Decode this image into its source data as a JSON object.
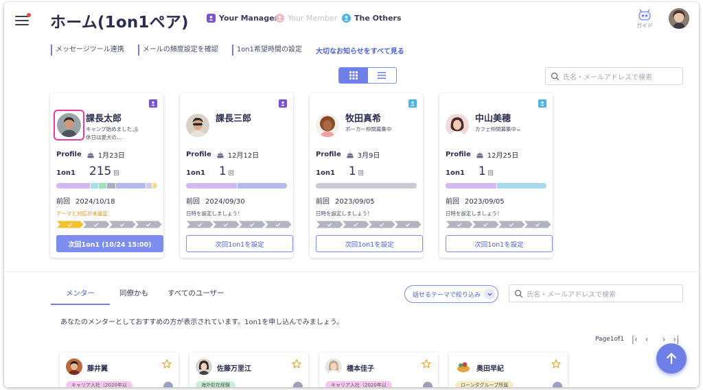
{
  "header": {
    "title": "ホーム(1on1ペア)",
    "legend": [
      {
        "label": "Your Manager",
        "color": "#7d4fd6",
        "active": true
      },
      {
        "label": "Your Member",
        "color": "#f0b8c0",
        "active": false
      },
      {
        "label": "The Others",
        "color": "#4db4e6",
        "active": true
      }
    ],
    "guide_label": "ガイド"
  },
  "links": [
    {
      "label": "メッセージツール連携"
    },
    {
      "label": "メールの頻度設定を確認"
    },
    {
      "label": "1on1希望時間の設定"
    }
  ],
  "all_notices_link": "大切なお知らせをすべて見る",
  "search_top": {
    "placeholder": "氏名・メールアドレスで検索"
  },
  "pair_cards": [
    {
      "name": "課長太郎",
      "role_icon": "manager-icon",
      "role_color": "#7d4fd6",
      "bio_line1": "キャンプ始めました🏕",
      "bio_line2": "休日は愛犬の…",
      "profile_label": "Profile",
      "birthday": "1月23日",
      "one_on_one_label": "1on1",
      "count": "215",
      "count_unit": "回",
      "bar_segments": [
        {
          "color": "#d3b8f1",
          "weight": 35
        },
        {
          "color": "#a7dfe8",
          "weight": 9
        },
        {
          "color": "#a6e0b9",
          "weight": 9
        },
        {
          "color": "#a9aec4",
          "weight": 9
        },
        {
          "color": "#b3b8ef",
          "weight": 32
        },
        {
          "color": "#c9cced",
          "weight": 6
        },
        {
          "color": "#f3dc92",
          "weight": 6
        }
      ],
      "prev_label": "前回",
      "prev_date": "2024/10/18",
      "note": "テーマと対応が未設定",
      "note_warn": true,
      "steps_done": 1,
      "button_label": "次回1on1 (10/24 15:00)",
      "button_filled": true
    },
    {
      "name": "課長三郎",
      "role_icon": "manager-icon",
      "role_color": "#7d4fd6",
      "bio_line1": "",
      "bio_line2": "",
      "profile_label": "Profile",
      "birthday": "12月12日",
      "one_on_one_label": "1on1",
      "count": "1",
      "count_unit": "回",
      "bar_segments": [
        {
          "color": "#d3b8f1",
          "weight": 50
        },
        {
          "color": "#b3b8ef",
          "weight": 50
        }
      ],
      "prev_label": "前回",
      "prev_date": "2024/09/30",
      "note": "日時を設定しましょう！",
      "note_warn": false,
      "steps_done": 0,
      "button_label": "次回1on1を設定",
      "button_filled": false
    },
    {
      "name": "牧田真希",
      "role_icon": "others-icon",
      "role_color": "#4db4e6",
      "bio_line1": "ポーカー仲間募集中",
      "bio_line2": "",
      "profile_label": "Profile",
      "birthday": "3月9日",
      "one_on_one_label": "1on1",
      "count": "1",
      "count_unit": "回",
      "bar_segments": [
        {
          "color": "#c9cad2",
          "weight": 100
        }
      ],
      "prev_label": "前回",
      "prev_date": "2023/09/05",
      "note": "日時を設定しましょう！",
      "note_warn": false,
      "steps_done": 0,
      "button_label": "次回1on1を設定",
      "button_filled": false
    },
    {
      "name": "中山美穂",
      "role_icon": "others-icon",
      "role_color": "#4db4e6",
      "bio_line1": "カフェ仲間募集中☕",
      "bio_line2": "",
      "profile_label": "Profile",
      "birthday": "12月25日",
      "one_on_one_label": "1on1",
      "count": "1",
      "count_unit": "回",
      "bar_segments": [
        {
          "color": "#d3b8f1",
          "weight": 50
        },
        {
          "color": "#a7d8ef",
          "weight": 50
        }
      ],
      "prev_label": "前回",
      "prev_date": "2023/09/05",
      "note": "日時を設定しましょう！",
      "note_warn": false,
      "steps_done": 0,
      "button_label": "次回1on1を設定",
      "button_filled": false
    }
  ],
  "tabs": [
    {
      "label": "メンター",
      "active": true
    },
    {
      "label": "同僚かも",
      "active": false
    },
    {
      "label": "すべてのユーザー",
      "active": false
    }
  ],
  "filter_label": "話せるテーマで絞り込み",
  "search_bottom": {
    "placeholder": "氏名・メールアドレスで検索"
  },
  "mentor_description": "あなたのメンターとしておすすめの方が表示されています。1on1を申し込んでみましょう。",
  "pager": {
    "text": "Page1of1"
  },
  "mentor_cards": [
    {
      "name": "藤井翼",
      "tag": "キャリア入社（2020年以",
      "tag_color": "#f7c8ee"
    },
    {
      "name": "佐藤万里江",
      "tag": "海外駐在経験",
      "tag_color": "#c8f0d6"
    },
    {
      "name": "橋本佳子",
      "tag": "キャリア入社（2020年以",
      "tag_color": "#f7c8ee"
    },
    {
      "name": "奥田早紀",
      "tag": "ローンダグループ所属",
      "tag_color": "#f6ecc4"
    }
  ]
}
